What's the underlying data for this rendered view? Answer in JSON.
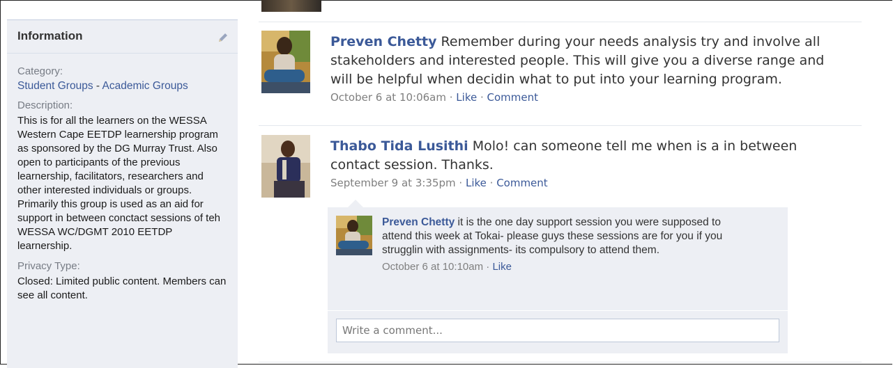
{
  "sidebar": {
    "title": "Information",
    "edit_icon": "pencil-icon",
    "category_label": "Category:",
    "category_primary": "Student Groups",
    "category_separator": " - ",
    "category_secondary": "Academic Groups",
    "description_label": "Description:",
    "description_text": "This is for all the learners on the WESSA Western Cape EETDP learnership program as sponsored by the DG Murray Trust. Also open to participants of the previous learnership, facilitators, researchers and other interested individuals or groups. Primarily this group is used as an aid for support in between conctact sessions of teh WESSA WC/DGMT 2010 EETDP learnership.",
    "privacy_label": "Privacy Type:",
    "privacy_text": "Closed: Limited public content. Members can see all content."
  },
  "posts": [
    {
      "author": "Preven Chetty",
      "message": " Remember during your needs analysis try and involve all stakeholders and interested people. This will give you a diverse range and will be helpful when decidin what to put into your learning program.",
      "timestamp": "October 6 at 10:06am",
      "like_label": "Like",
      "comment_label": "Comment",
      "dot": " · "
    },
    {
      "author": "Thabo Tida Lusithi",
      "message": " Molo! can someone tell me when is a in between contact session. Thanks.",
      "timestamp": "September 9 at 3:35pm",
      "like_label": "Like",
      "comment_label": "Comment",
      "dot": " · "
    }
  ],
  "reply": {
    "author": "Preven Chetty",
    "message": " it is the one day support session you were supposed to attend this week at Tokai- please guys these sessions are for you if you strugglin with assignments- its compulsory to attend them.",
    "timestamp": "October 6 at 10:10am",
    "like_label": "Like",
    "dot": " · "
  },
  "comment_input": {
    "placeholder": "Write a comment..."
  },
  "colors": {
    "link": "#3b5998",
    "sidebar_bg": "#edeff4",
    "meta": "#7f7f7f"
  }
}
